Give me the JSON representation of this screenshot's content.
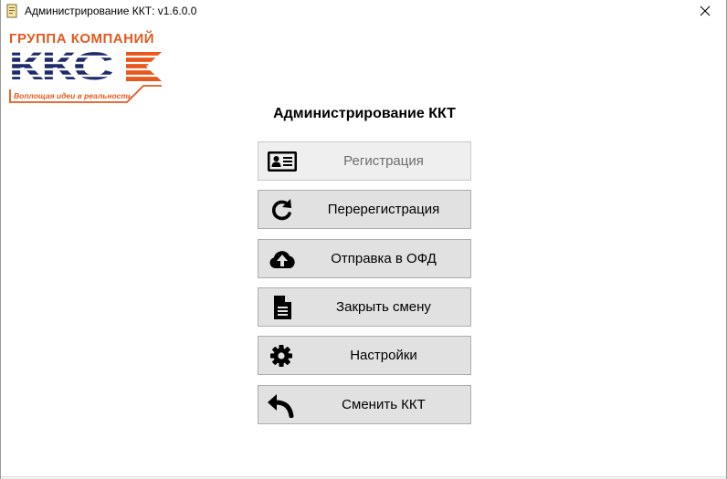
{
  "window": {
    "title": "Администрирование ККТ: v1.6.0.0"
  },
  "logo": {
    "top_text": "ГРУППА КОМПАНИЙ",
    "brand": "ККС",
    "slogan": "Воплощая идеи в реальность",
    "colors": {
      "orange": "#e8581c",
      "navy": "#1c2a6b"
    }
  },
  "heading": "Администрирование ККТ",
  "buttons": [
    {
      "label": "Регистрация",
      "icon": "id-card-icon",
      "enabled": false
    },
    {
      "label": "Перерегистрация",
      "icon": "refresh-icon",
      "enabled": true
    },
    {
      "label": "Отправка в ОФД",
      "icon": "cloud-upload-icon",
      "enabled": true
    },
    {
      "label": "Закрыть смену",
      "icon": "document-icon",
      "enabled": true
    },
    {
      "label": "Настройки",
      "icon": "gear-icon",
      "enabled": true
    },
    {
      "label": "Сменить ККТ",
      "icon": "reply-arrow-icon",
      "enabled": true
    }
  ]
}
